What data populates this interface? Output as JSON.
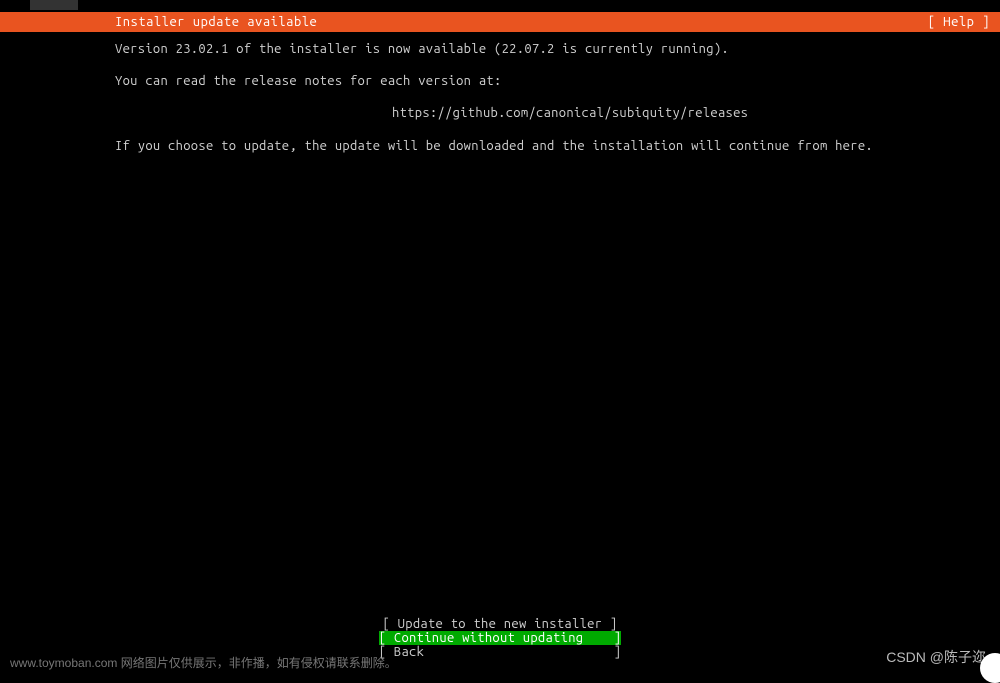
{
  "header": {
    "title": "Installer update available",
    "help": "[ Help ]"
  },
  "content": {
    "line1": "Version 23.02.1 of the installer is now available (22.07.2 is currently running).",
    "line2": "You can read the release notes for each version at:",
    "url": "https://github.com/canonical/subiquity/releases",
    "line3": "If you choose to update, the update will be downloaded and the installation will continue from here."
  },
  "buttons": {
    "update": "[ Update to the new installer ]",
    "continue": "[ Continue without updating    ]",
    "back": "[ Back                         ]"
  },
  "watermark": {
    "left": "www.toymoban.com 网络图片仅供展示，非作播，如有侵权请联系删除。",
    "right": "CSDN @陈子迩"
  }
}
